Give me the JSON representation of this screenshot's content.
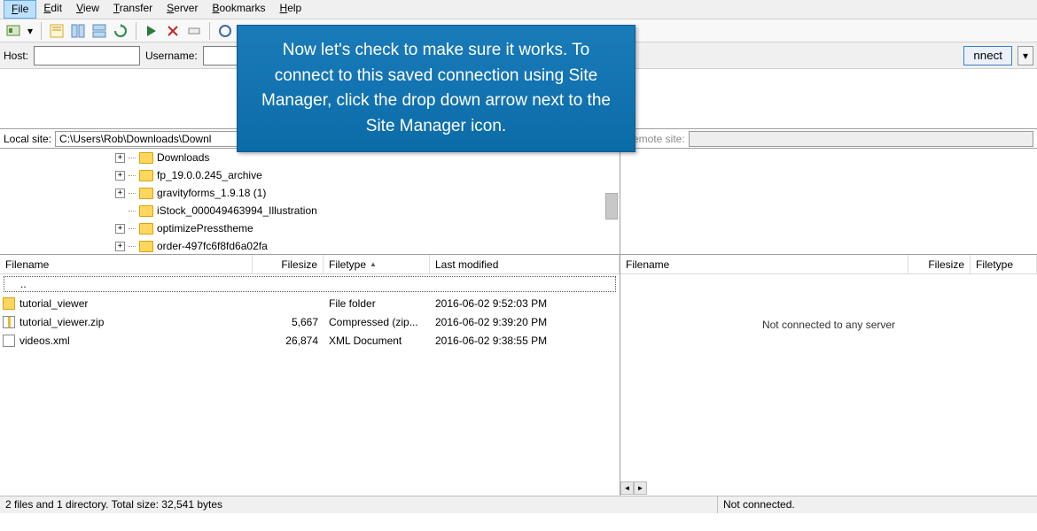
{
  "menu": {
    "file": "File",
    "edit": "Edit",
    "view": "View",
    "transfer": "Transfer",
    "server": "Server",
    "bookmarks": "Bookmarks",
    "help": "Help"
  },
  "quickconnect": {
    "host_label": "Host:",
    "host_value": "",
    "username_label": "Username:",
    "username_value": "",
    "connect_label": "nnect"
  },
  "local_site": {
    "label": "Local site:",
    "path": "C:\\Users\\Rob\\Downloads\\Downl"
  },
  "remote_site": {
    "label": "emote site:",
    "path": ""
  },
  "tree": [
    {
      "name": "Downloads",
      "expanded": false
    },
    {
      "name": "fp_19.0.0.245_archive",
      "expanded": false
    },
    {
      "name": "gravityforms_1.9.18 (1)",
      "expanded": false
    },
    {
      "name": "iStock_000049463994_Illustration",
      "expanded": null
    },
    {
      "name": "optimizePresstheme",
      "expanded": false
    },
    {
      "name": "order-497fc6f8fd6a02fa",
      "expanded": false
    }
  ],
  "columns": {
    "filename": "Filename",
    "filesize": "Filesize",
    "filetype": "Filetype",
    "lastmod": "Last modified"
  },
  "files": [
    {
      "icon": "folder",
      "name": "tutorial_viewer",
      "size": "",
      "type": "File folder",
      "mod": "2016-06-02 9:52:03 PM"
    },
    {
      "icon": "zip",
      "name": "tutorial_viewer.zip",
      "size": "5,667",
      "type": "Compressed (zip...",
      "mod": "2016-06-02 9:39:20 PM"
    },
    {
      "icon": "xml",
      "name": "videos.xml",
      "size": "26,874",
      "type": "XML Document",
      "mod": "2016-06-02 9:38:55 PM"
    }
  ],
  "dotdot": "..",
  "remote_msg": "Not connected to any server",
  "status": {
    "left": "2 files and 1 directory. Total size: 32,541 bytes",
    "right": "Not connected."
  },
  "overlay_text": "Now let's check to make sure it works. To connect to this saved connection using Site Manager, click the drop down arrow next to the Site Manager icon."
}
